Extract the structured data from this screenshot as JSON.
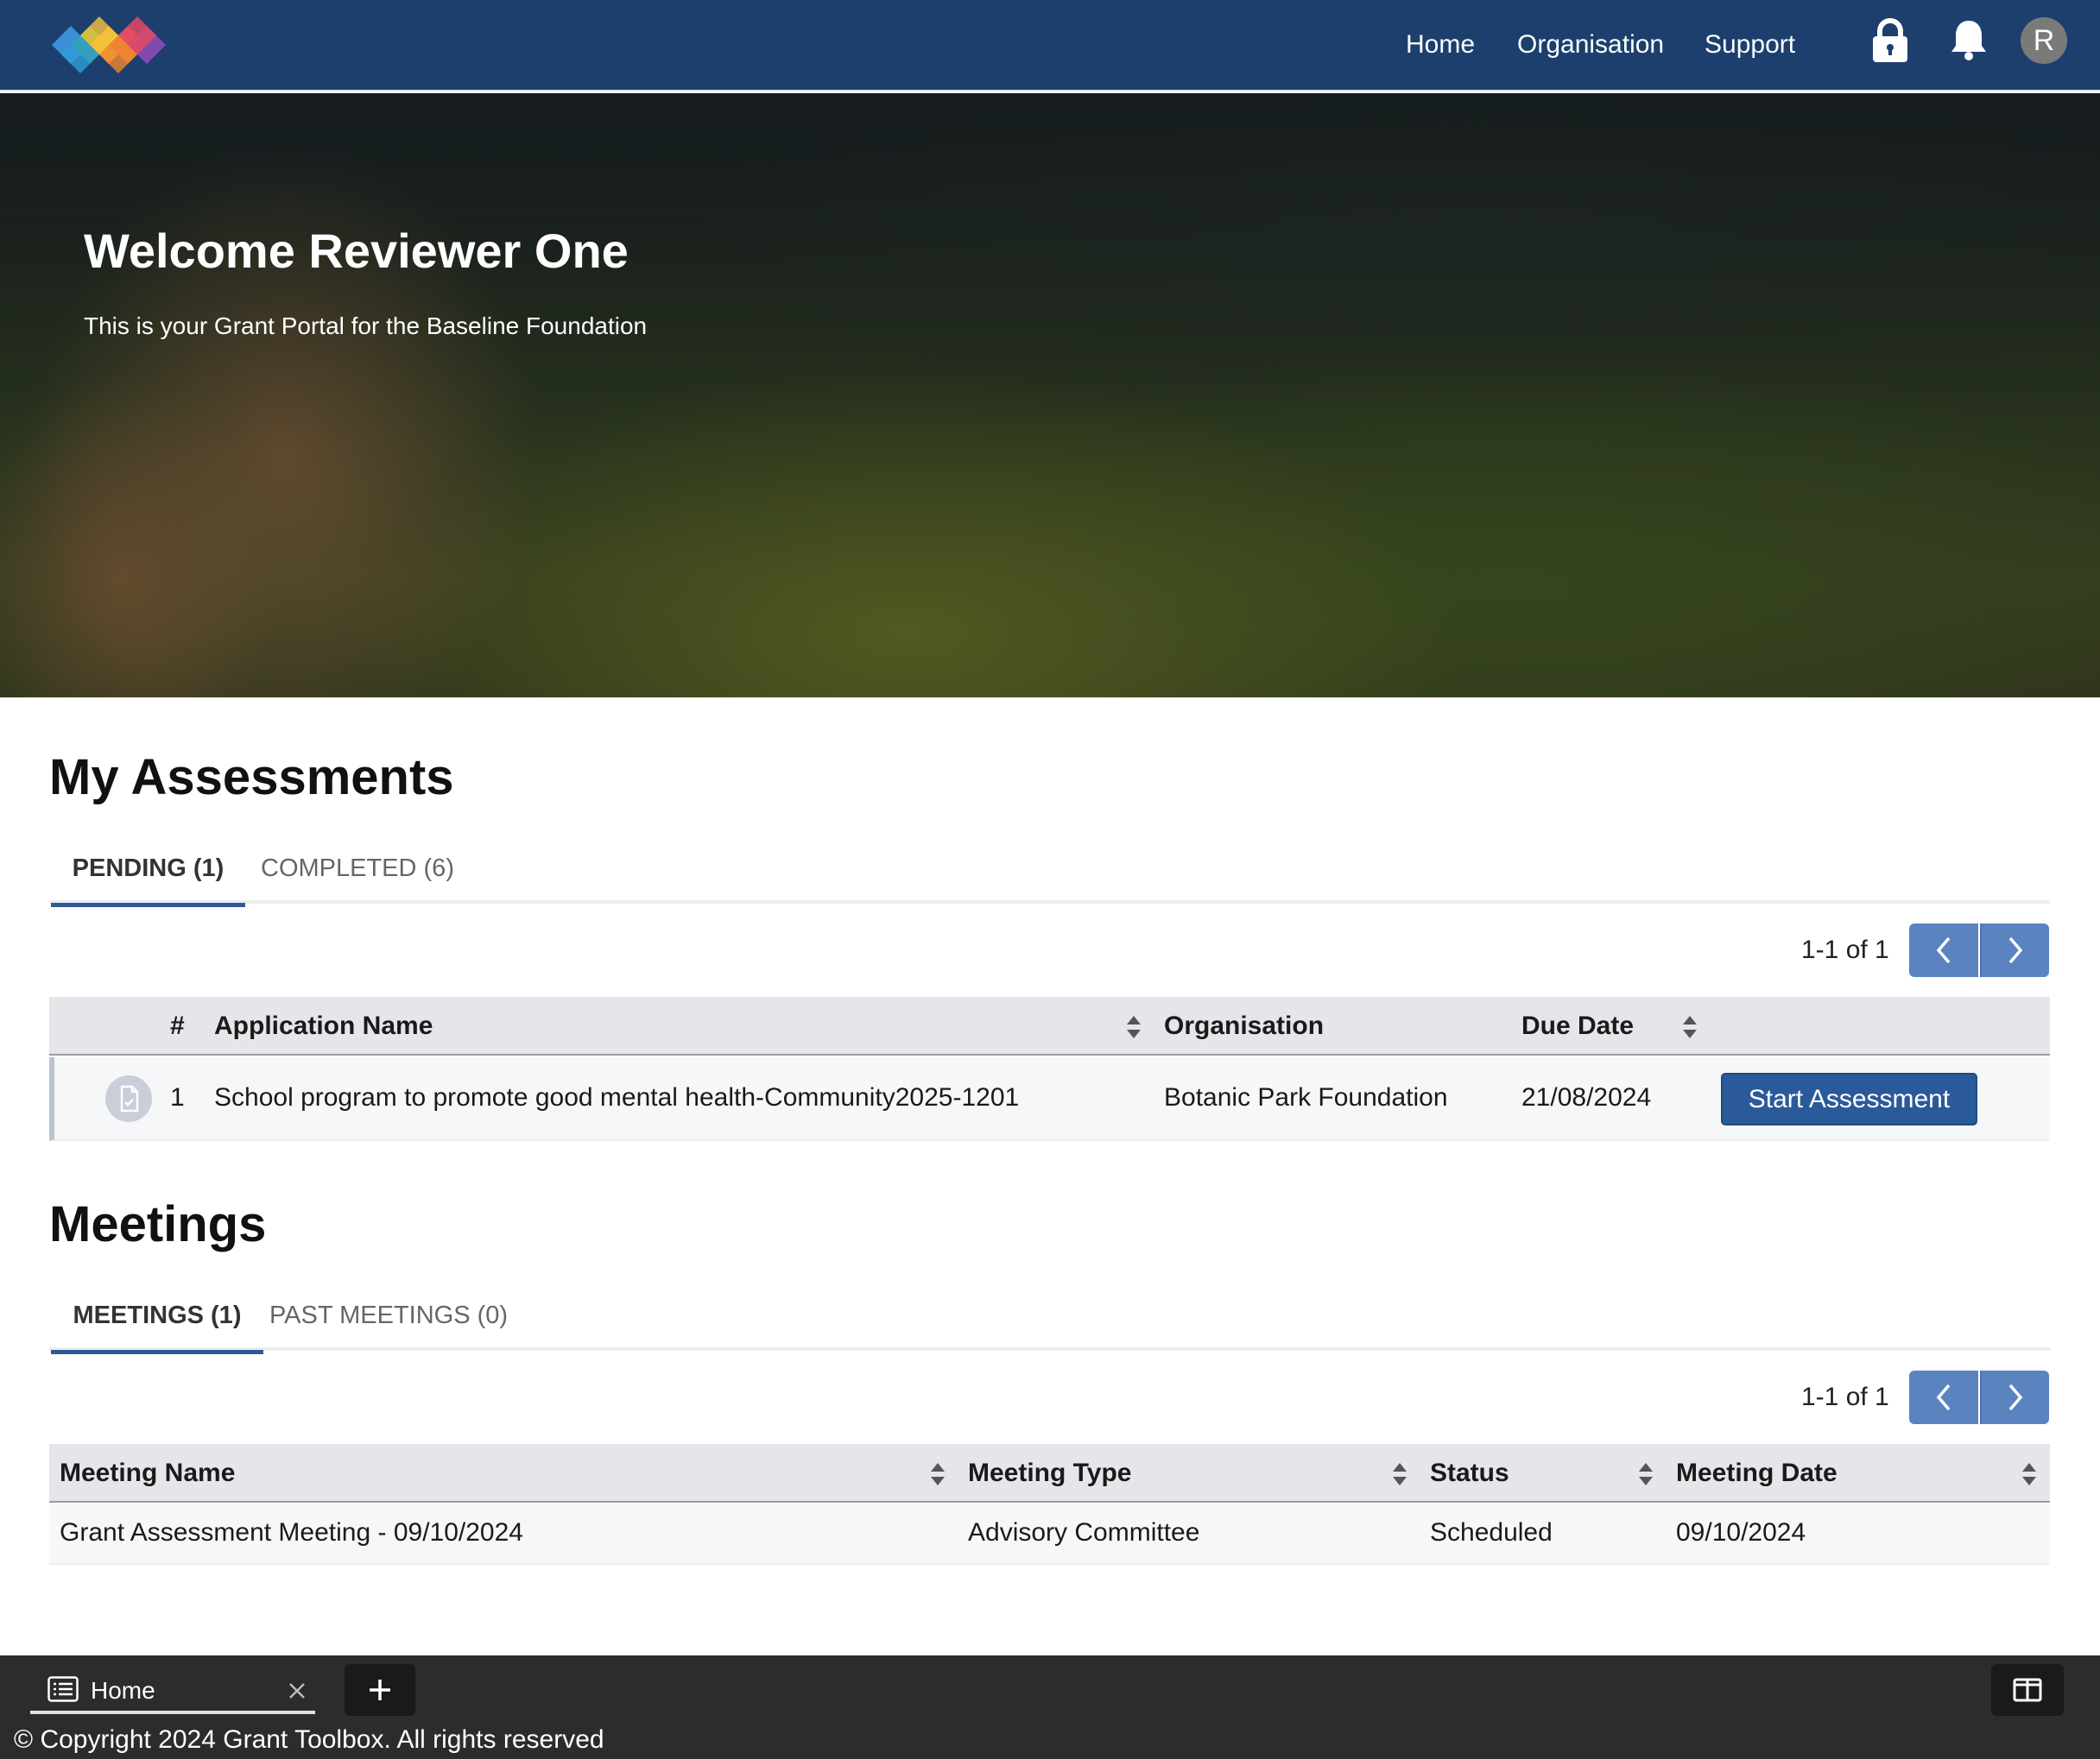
{
  "nav": {
    "links": [
      "Home",
      "Organisation",
      "Support"
    ],
    "avatar_initial": "R",
    "brand_colors": [
      "#3a8fd6",
      "#4caf50",
      "#f5b82e",
      "#ef6c3a",
      "#e24a63",
      "#8e4bb5"
    ]
  },
  "hero": {
    "title": "Welcome Reviewer One",
    "subtitle": "This is your Grant Portal for the Baseline Foundation"
  },
  "assessments": {
    "title": "My Assessments",
    "tabs": [
      {
        "label": "PENDING (1)",
        "active": true
      },
      {
        "label": "COMPLETED (6)",
        "active": false
      }
    ],
    "pager": "1-1 of 1",
    "columns": [
      "#",
      "Application Name",
      "Organisation",
      "Due Date"
    ],
    "rows": [
      {
        "num": "1",
        "application_name": "School program to promote good mental health-Community2025-1201",
        "organisation": "Botanic Park Foundation",
        "due_date": "21/08/2024",
        "action": "Start Assessment"
      }
    ]
  },
  "meetings": {
    "title": "Meetings",
    "tabs": [
      {
        "label": "MEETINGS (1)",
        "active": true
      },
      {
        "label": "PAST MEETINGS (0)",
        "active": false
      }
    ],
    "pager": "1-1 of 1",
    "columns": [
      "Meeting Name",
      "Meeting Type",
      "Status",
      "Meeting Date"
    ],
    "rows": [
      {
        "meeting_name": "Grant Assessment Meeting - 09/10/2024",
        "meeting_type": "Advisory Committee",
        "status": "Scheduled",
        "meeting_date": "09/10/2024"
      }
    ]
  },
  "footer": {
    "tab_label": "Home",
    "copyright": "© Copyright 2024 Grant Toolbox. All rights reserved"
  },
  "colors": {
    "header_bg": "#1d3f6e",
    "primary_button": "#2b5a9a",
    "pager_button": "#5a83bf",
    "footer_bg": "#2c2c2c"
  },
  "icons": [
    "brand-logo",
    "lock-icon",
    "bell-icon",
    "document-icon",
    "sort-icon",
    "chevron-left-icon",
    "chevron-right-icon",
    "list-icon",
    "close-icon",
    "plus-icon",
    "split-view-icon"
  ]
}
